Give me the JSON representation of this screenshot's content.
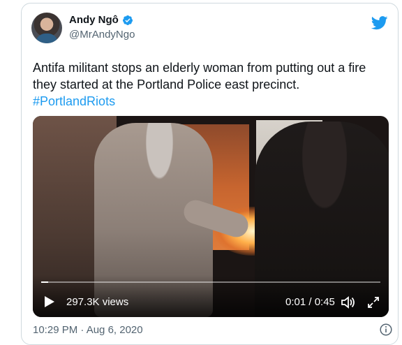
{
  "tweet": {
    "author_name": "Andy Ngô",
    "author_handle": "@MrAndyNgo",
    "text": "Antifa militant stops an elderly woman from putting out a fire they started at the Portland Police east precinct.",
    "hashtag": "#PortlandRiots",
    "timestamp": "10:29 PM · Aug 6, 2020"
  },
  "video": {
    "views": "297.3K views",
    "time": "0:01 / 0:45",
    "progress_fraction": 0.02
  },
  "icons": {
    "verified": "verified-badge-icon",
    "brand": "twitter-bird-icon",
    "play": "play-icon",
    "volume": "volume-icon",
    "expand": "expand-icon",
    "info": "info-icon"
  },
  "colors": {
    "brand_blue": "#1d9bf0",
    "secondary_text": "#536471",
    "border": "#cfd9de"
  }
}
